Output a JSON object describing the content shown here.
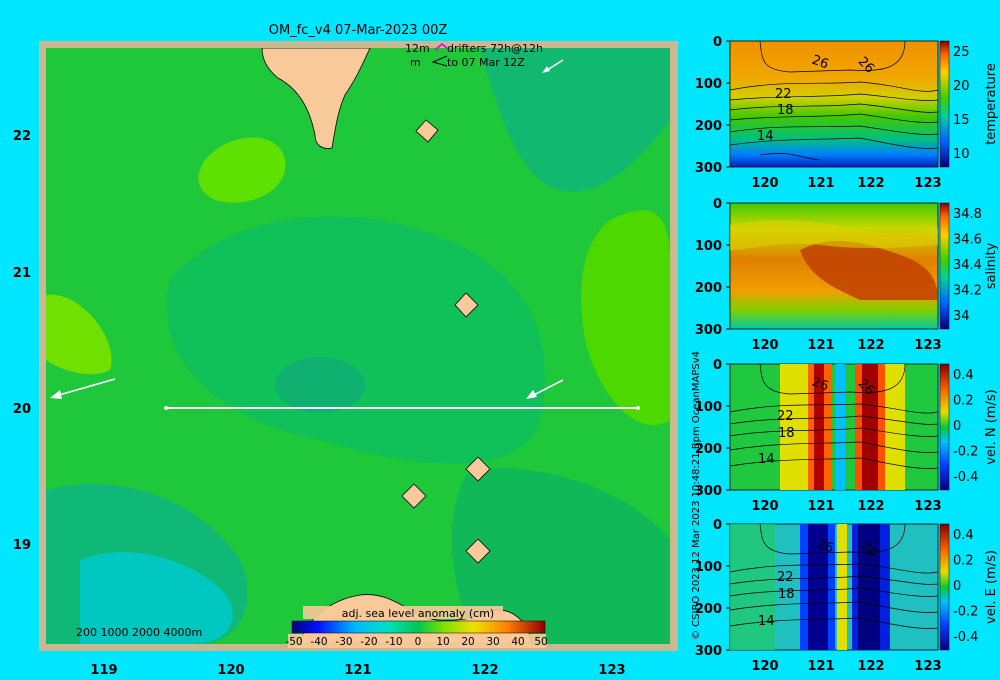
{
  "map": {
    "title": "OM_fc_v4  07-Mar-2023 00Z",
    "drifter_legend": {
      "line1_left": "12m",
      "line1_right": "drifters 72h@12h",
      "line2_left": "m",
      "line2_right": "to 07 Mar 12Z"
    },
    "x_ticks": [
      "119",
      "120",
      "121",
      "122",
      "123"
    ],
    "y_ticks": [
      "22",
      "21",
      "20",
      "19"
    ],
    "depth_legend": "200  1000  2000  4000m",
    "colorbar": {
      "label": "adj. sea level anomaly (cm)",
      "ticks": [
        "-50",
        "-40",
        "-30",
        "-20",
        "-10",
        "0",
        "10",
        "20",
        "30",
        "40",
        "50"
      ]
    },
    "section_line": {
      "lon_start": 119.5,
      "lon_end": 123.2,
      "lat": 20.0
    }
  },
  "credit_vertical": "© CSIRO 2023    12 Mar 2023 10:48:21 Bpm OceanMAPSv4",
  "panels": [
    {
      "id": "temperature",
      "ylabel": "temperature",
      "cbar_ticks": [
        "25",
        "20",
        "15",
        "10"
      ],
      "contour_labels": [
        "26",
        "26",
        "22",
        "18",
        "14"
      ],
      "y_ticks": [
        "0",
        "100",
        "200",
        "300"
      ],
      "x_ticks": [
        "120",
        "121",
        "122",
        "123"
      ]
    },
    {
      "id": "salinity",
      "ylabel": "salinity",
      "cbar_ticks": [
        "34.8",
        "34.6",
        "34.4",
        "34.2",
        "34"
      ],
      "contour_labels": [],
      "y_ticks": [
        "0",
        "100",
        "200",
        "300"
      ],
      "x_ticks": [
        "120",
        "121",
        "122",
        "123"
      ]
    },
    {
      "id": "vel_n",
      "ylabel": "vel. N (m/s)",
      "cbar_ticks": [
        "0.4",
        "0.2",
        "0",
        "-0.2",
        "-0.4"
      ],
      "contour_labels": [
        "26",
        "26",
        "22",
        "18",
        "14"
      ],
      "y_ticks": [
        "0",
        "100",
        "200",
        "300"
      ],
      "x_ticks": [
        "120",
        "121",
        "122",
        "123"
      ]
    },
    {
      "id": "vel_e",
      "ylabel": "vel. E (m/s)",
      "cbar_ticks": [
        "0.4",
        "0.2",
        "0",
        "-0.2",
        "-0.4"
      ],
      "contour_labels": [
        "26",
        "26",
        "22",
        "18",
        "14"
      ],
      "y_ticks": [
        "0",
        "100",
        "200",
        "300"
      ],
      "x_ticks": [
        "120",
        "121",
        "122",
        "123"
      ]
    }
  ],
  "colors": {
    "background": "#00e6ff",
    "land": "#f8c999",
    "frame": "#c9b890",
    "sea_base": "#1fc83a"
  }
}
